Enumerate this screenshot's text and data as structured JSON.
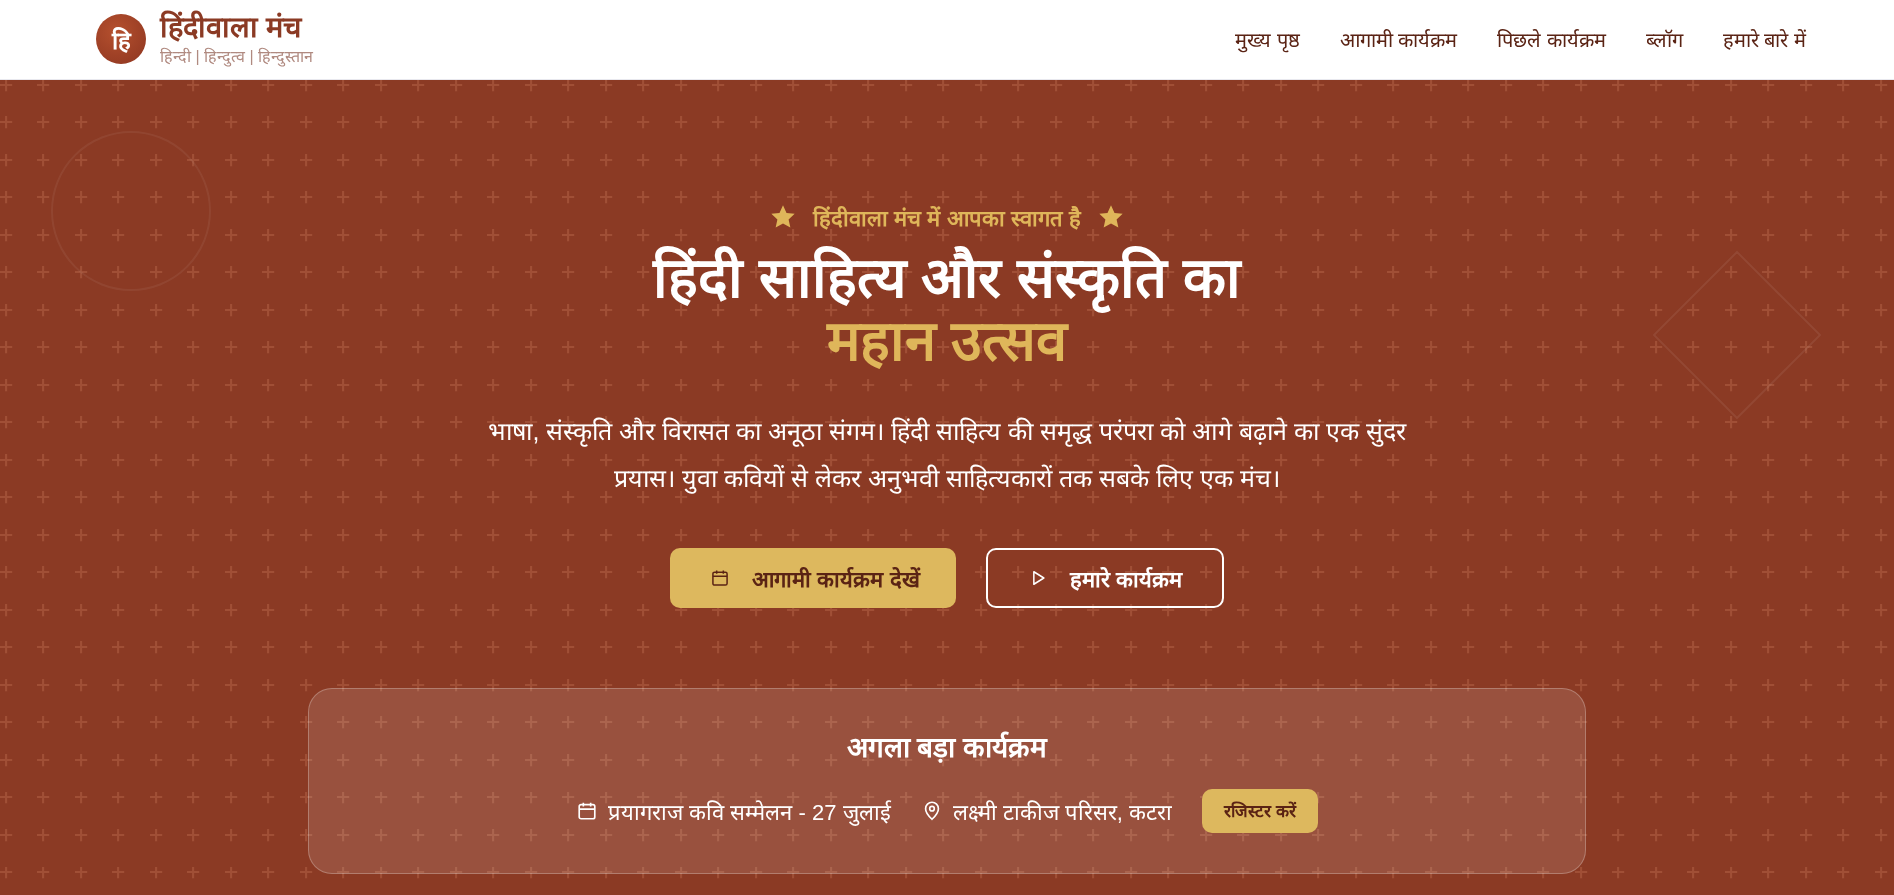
{
  "header": {
    "logo_letter": "हि",
    "title": "हिंदीवाला मंच",
    "tagline": "हिन्दी | हिन्दुत्व | हिन्दुस्तान",
    "nav": [
      {
        "label": "मुख्य पृष्ठ"
      },
      {
        "label": "आगामी कार्यक्रम"
      },
      {
        "label": "पिछले कार्यक्रम"
      },
      {
        "label": "ब्लॉग"
      },
      {
        "label": "हमारे बारे में"
      }
    ]
  },
  "hero": {
    "welcome": "हिंदीवाला मंच में आपका स्वागत है",
    "title": "हिंदी साहित्य और संस्कृति का",
    "highlight": "महान उत्सव",
    "description": "भाषा, संस्कृति और विरासत का अनूठा संगम। हिंदी साहित्य की समृद्ध परंपरा को आगे बढ़ाने का एक सुंदर प्रयास। युवा कवियों से लेकर अनुभवी साहित्यकारों तक सबके लिए एक मंच।",
    "buttons": [
      {
        "label": "आगामी कार्यक्रम देखें",
        "kind": "primary"
      },
      {
        "label": "हमारे कार्यक्रम",
        "kind": "outline"
      }
    ]
  },
  "next_event": {
    "heading": "अगला बड़ा कार्यक्रम",
    "event": "प्रयागराज कवि सम्मेलन - 27 जुलाई",
    "location": "लक्ष्मी टाकीज परिसर, कटरा",
    "button": "रजिस्टर करें"
  }
}
